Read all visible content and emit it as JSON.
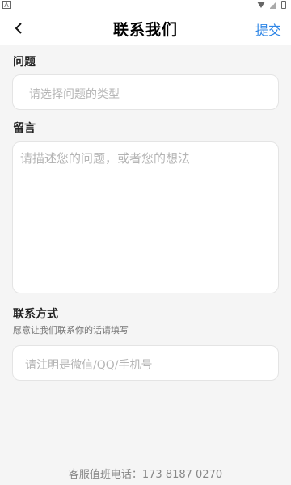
{
  "status_bar": {
    "left_icon": "notification-a-icon",
    "right_icons": [
      "wifi-icon",
      "signal-icon",
      "battery-icon"
    ]
  },
  "header": {
    "title": "联系我们",
    "back_icon": "chevron-left-icon",
    "submit_label": "提交"
  },
  "question": {
    "label": "问题",
    "placeholder": "请选择问题的类型"
  },
  "message": {
    "label": "留言",
    "placeholder": "请描述您的问题，或者您的想法"
  },
  "contact": {
    "label": "联系方式",
    "hint": "愿意让我们联系你的话请填写",
    "placeholder": "请注明是微信/QQ/手机号"
  },
  "footer": {
    "phone_text": "客服值班电话：173 8187 0270"
  },
  "colors": {
    "accent": "#2f86e6",
    "background": "#f5f5f5",
    "field_bg": "#ffffff",
    "placeholder": "#b5b5b5"
  }
}
